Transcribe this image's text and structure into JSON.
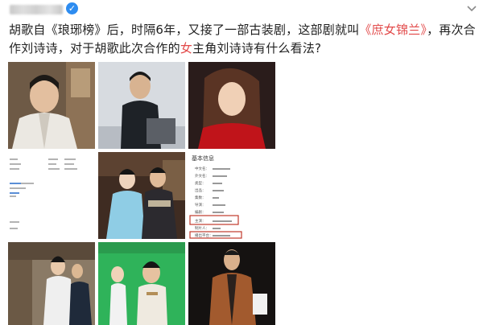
{
  "post": {
    "text_p1": "胡歌自《琅琊榜》后，时隔6年，又接了一部古装剧，这部剧就叫",
    "drama_title": "《庶女锦兰》",
    "text_p2": "，再次合作刘诗诗，对于胡歌此次合作的",
    "hl_char": "女",
    "text_p3": "主角刘诗诗有什么看法?"
  },
  "doc_card": {
    "title": "基本信息",
    "rows": [
      "中文名：",
      "外文名：",
      "类型：",
      "出品：",
      "集数：",
      "导演：",
      "编剧：",
      "主演：",
      "制片人：",
      "播出平台："
    ]
  },
  "icons": {
    "verified": "verified-check-icon",
    "chevron": "chevron-down-icon"
  },
  "colors": {
    "highlight": "#e24949",
    "verified": "#2d8cf0",
    "text": "#1f1f1f",
    "annotation_box": "#c0392b"
  }
}
